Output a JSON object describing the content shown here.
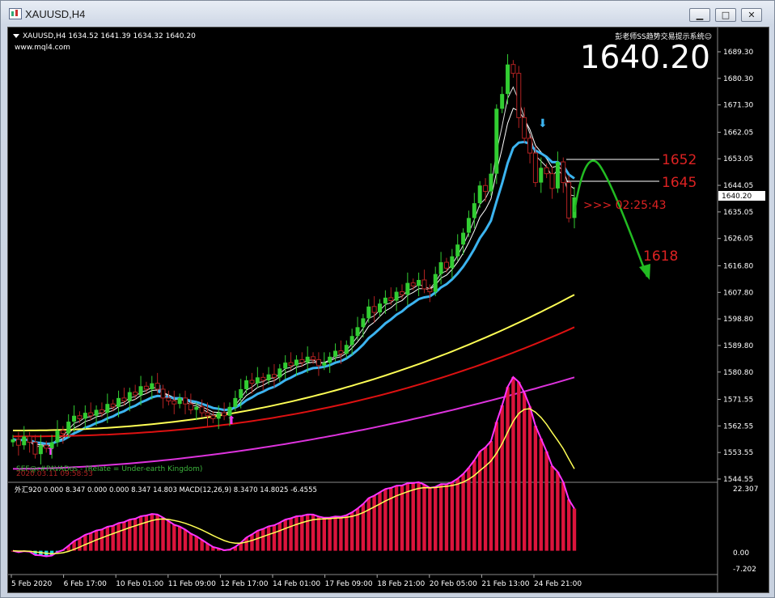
{
  "window": {
    "title": "XAUUSD,H4",
    "minimize_glyph": "▁",
    "maximize_glyph": "□",
    "close_glyph": "✕"
  },
  "chart_info": {
    "symbol_line": "XAUUSD,H4  1634.52 1641.39 1634.32 1640.20",
    "website": "www.mql4.com",
    "system_name": "彭老师SS趋势交易提示系统☺",
    "big_price": "1640.20",
    "current_price_tag": "1640.20",
    "levels": [
      "1652",
      "1645",
      "1618"
    ],
    "countdown": ">>> 02:25:43",
    "watermark_line1": "SEF@r#PAVADos - (Relate = Under-earth Kingdom)",
    "watermark_line2": "                 2020.03.11 09:58:53"
  },
  "indicator_panel": {
    "label": "外汇920 0.000 8.347 0.000 0.000 8.347 14.803  MACD(12,26,9) 8.3470 14.8025 -6.4555",
    "scale": [
      "22.307",
      "0.00",
      "-7.202"
    ]
  },
  "colors": {
    "background": "#000000",
    "bull_candle": "#32cd32",
    "bear_candle": "#b22222",
    "ma_fast": "#3cb4f0",
    "ma_yellow": "#ffff55",
    "ma_red": "#dd1111",
    "ma_magenta": "#dd33dd",
    "forecast_arrow": "#22bb22",
    "level_text": "#dd2222",
    "macd_hist": "#dc143c",
    "macd_neg_hist": "#22dddd"
  },
  "chart_data": {
    "type": "candlestick",
    "price_axis": {
      "ticks": [
        1689.3,
        1680.3,
        1671.3,
        1662.05,
        1653.05,
        1644.05,
        1635.05,
        1626.05,
        1616.8,
        1607.8,
        1598.8,
        1589.8,
        1580.8,
        1571.55,
        1562.55,
        1553.55,
        1544.55
      ],
      "range": [
        1544.55,
        1689.3
      ]
    },
    "time_axis": {
      "labels": [
        "5 Feb 2020",
        "6 Feb 17:00",
        "10 Feb 01:00",
        "11 Feb 09:00",
        "12 Feb 17:00",
        "14 Feb 01:00",
        "17 Feb 09:00",
        "18 Feb 21:00",
        "20 Feb 05:00",
        "21 Feb 13:00",
        "24 Feb 21:00"
      ]
    },
    "close_series": [
      1558,
      1556,
      1559,
      1557,
      1553,
      1556,
      1555,
      1557,
      1561,
      1560,
      1564,
      1566,
      1565,
      1567,
      1566,
      1568,
      1567,
      1570,
      1569,
      1572,
      1571,
      1574,
      1573,
      1576,
      1575,
      1577,
      1575,
      1572,
      1571,
      1570,
      1572,
      1570,
      1568,
      1569,
      1567,
      1566,
      1565,
      1567,
      1566,
      1569,
      1572,
      1575,
      1578,
      1577,
      1579,
      1578,
      1580,
      1579,
      1582,
      1584,
      1583,
      1585,
      1584,
      1586,
      1585,
      1583,
      1584,
      1586,
      1588,
      1587,
      1590,
      1593,
      1596,
      1599,
      1603,
      1601,
      1604,
      1606,
      1605,
      1608,
      1607,
      1611,
      1610,
      1612,
      1609,
      1608,
      1614,
      1618,
      1616,
      1620,
      1624,
      1628,
      1633,
      1638,
      1644,
      1642,
      1648,
      1670,
      1675,
      1685,
      1682,
      1667,
      1660,
      1655,
      1645,
      1650,
      1648,
      1643,
      1652,
      1645,
      1633,
      1640
    ],
    "ma_fast_last": 1644,
    "ma_yellow_last": 1607,
    "ma_red_last": 1596,
    "ma_magenta_last": 1579,
    "forecast": {
      "from": 1636,
      "peak": 1652,
      "target": 1618
    },
    "macd_hist_last": 14.8,
    "macd_signal_last": 8.35
  }
}
